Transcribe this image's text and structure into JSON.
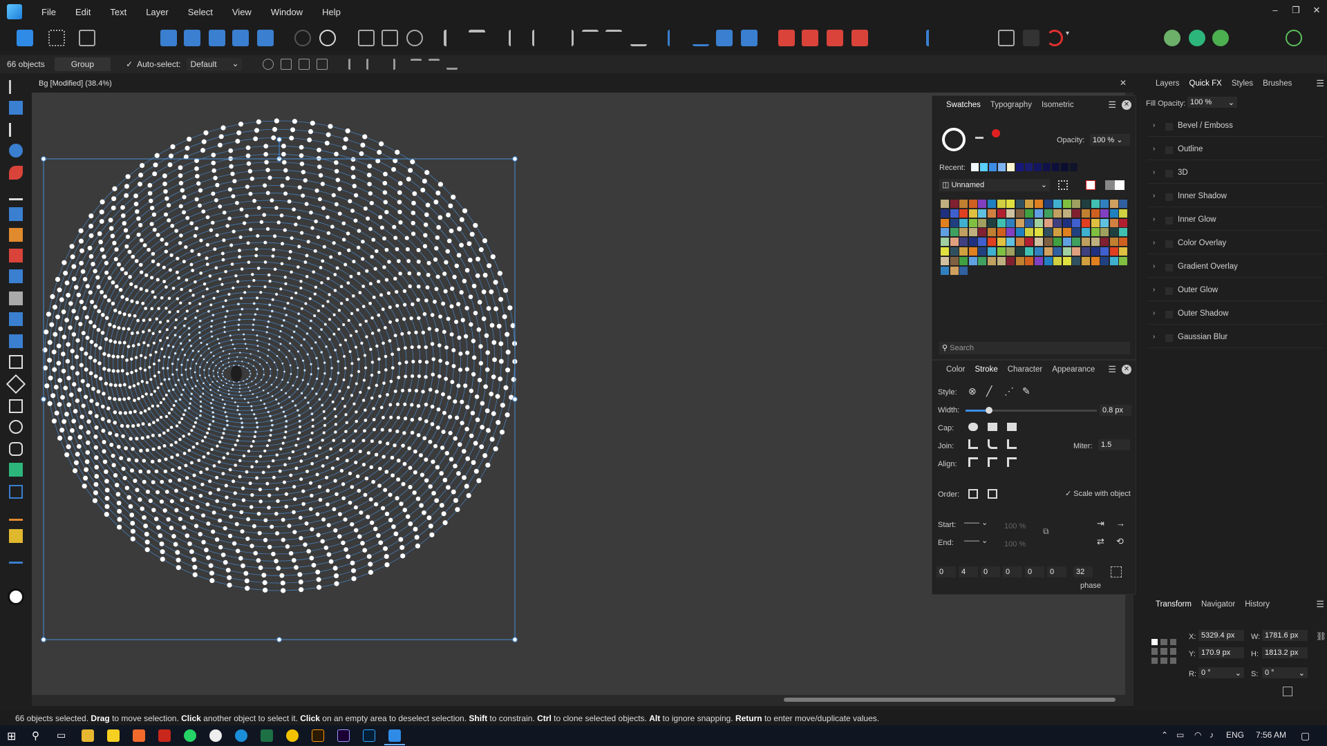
{
  "menubar": {
    "items": [
      "File",
      "Edit",
      "Text",
      "Layer",
      "Select",
      "View",
      "Window",
      "Help"
    ]
  },
  "context": {
    "object_count": "66 objects",
    "group_button": "Group",
    "autoselect_label": "Auto-select:",
    "autoselect_value": "Default"
  },
  "document": {
    "tab_title": "Bg [Modified] (38.4%)"
  },
  "swatches_panel": {
    "tabs": [
      "Swatches",
      "Typography",
      "Isometric"
    ],
    "opacity_label": "Opacity:",
    "opacity_value": "100 %",
    "recent_label": "Recent:",
    "palette_name": "Unnamed",
    "search_placeholder": "Search"
  },
  "stroke_panel": {
    "tabs": [
      "Color",
      "Stroke",
      "Character",
      "Appearance"
    ],
    "style_label": "Style:",
    "width_label": "Width:",
    "width_value": "0.8 px",
    "width_fraction": 0.18,
    "cap_label": "Cap:",
    "join_label": "Join:",
    "align_label": "Align:",
    "miter_label": "Miter:",
    "miter_value": "1.5",
    "order_label": "Order:",
    "scale_label": "Scale with object",
    "start_label": "Start:",
    "end_label": "End:",
    "start_pct": "100 %",
    "end_pct": "100 %",
    "dash_values": [
      "0",
      "4",
      "0",
      "0",
      "0",
      "0"
    ],
    "phase_value": "32",
    "phase_label": "phase"
  },
  "right_panel": {
    "tabs": [
      "Layers",
      "Quick FX",
      "Styles",
      "Brushes"
    ],
    "fill_opacity_label": "Fill Opacity:",
    "fill_opacity_value": "100 %",
    "effects": [
      "Bevel / Emboss",
      "Outline",
      "3D",
      "Inner Shadow",
      "Inner Glow",
      "Color Overlay",
      "Gradient Overlay",
      "Outer Glow",
      "Outer Shadow",
      "Gaussian Blur"
    ]
  },
  "transform_panel": {
    "tabs": [
      "Transform",
      "Navigator",
      "History"
    ],
    "x_label": "X:",
    "x_value": "5329.4 px",
    "y_label": "Y:",
    "y_value": "170.9 px",
    "w_label": "W:",
    "w_value": "1781.6 px",
    "h_label": "H:",
    "h_value": "1813.2 px",
    "r_label": "R:",
    "r_value": "0 °",
    "s_label": "S:",
    "s_value": "0 °"
  },
  "status": {
    "t1": "66 objects selected. ",
    "b1": "Drag",
    "t2": " to move selection. ",
    "b2": "Click",
    "t3": " another object to select it. ",
    "b3": "Click",
    "t4": " on an empty area to deselect selection. ",
    "b4": "Shift",
    "t5": " to constrain. ",
    "b5": "Ctrl",
    "t6": " to clone selected objects. ",
    "b6": "Alt",
    "t7": " to ignore snapping. ",
    "b7": "Return",
    "t8": " to enter move/duplicate values."
  },
  "taskbar": {
    "lang": "ENG",
    "time": "7:56 AM"
  },
  "colors": {
    "accent": "#3d8ce6",
    "guide": "#4a8fd8",
    "canvas": "#3b3b3b"
  }
}
